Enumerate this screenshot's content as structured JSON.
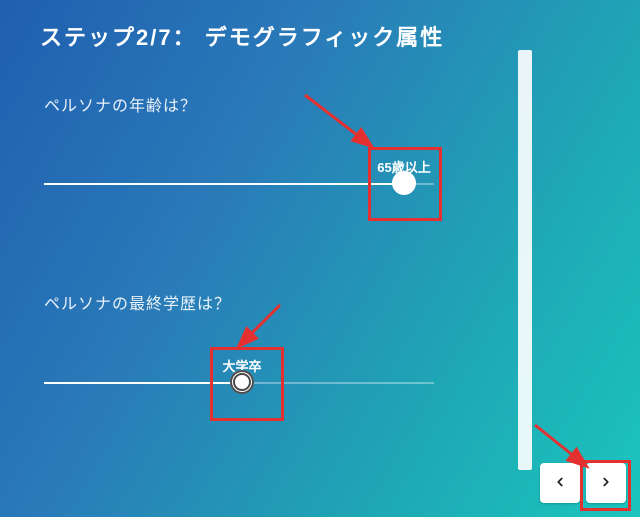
{
  "step_title": "ステップ2/7： デモグラフィック属性",
  "questions": {
    "age": {
      "prompt": "ペルソナの年齢は？",
      "value_label": "65歳以上"
    },
    "education": {
      "prompt": "ペルソナの最終学歴は？",
      "value_label": "大学卒"
    }
  },
  "nav": {
    "prev_icon": "chevron-left",
    "next_icon": "chevron-right"
  }
}
